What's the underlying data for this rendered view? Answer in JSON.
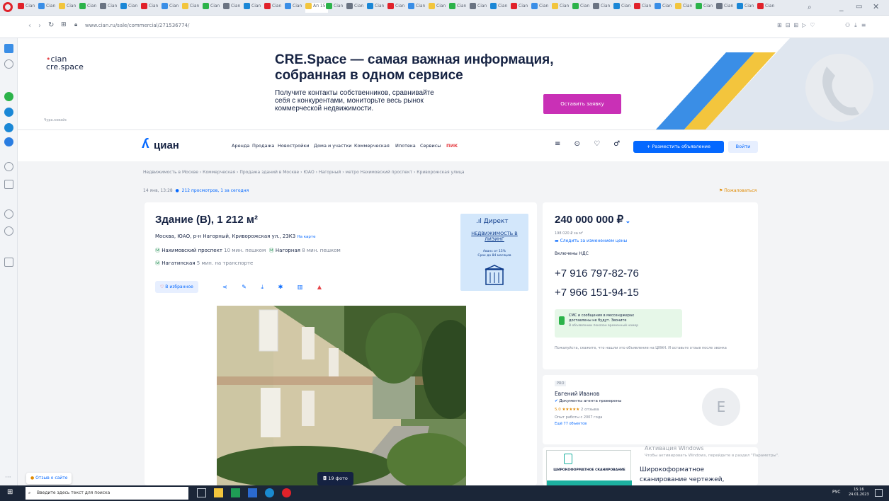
{
  "browser": {
    "url": "www.cian.ru/sale/commercial/271536774/",
    "tabs": [
      {
        "label": "Cian"
      }
    ],
    "active_tab_label": "Ап 15 ×"
  },
  "banner": {
    "logo_line1": "cian",
    "logo_line2": "cre.space",
    "headline_1": "CRE.Space — самая важная информация,",
    "headline_2": "собранная в одном сервисе",
    "body_1": "Получите контакты собственников, сравнивайте",
    "body_2": "себя с конкурентами, мониторьте весь рынок",
    "body_3": "коммерческой недвижимости.",
    "cta": "Оставить заявку",
    "ad_label": "Чура.ковайс"
  },
  "header": {
    "logo": "циан",
    "nav": [
      "Аренда",
      "Продажа",
      "Новостройки",
      "Дома и участки",
      "Коммерческая",
      "Ипотека",
      "Сервисы",
      "ПИК"
    ],
    "post_button": "+ Разместить объявление",
    "login_button": "Войти"
  },
  "breadcrumbs": "Недвижимость в Москве  ›  Коммерческая  ›  Продажа зданий в Москве  ›  ЮАО  ›  Нагорный  ›  метро Нахимовский проспект  ›  Криворожская улица",
  "meta": {
    "date": "14 янв, 13:28",
    "views": "212 просмотров, 1 за сегодня",
    "complain": "Пожаловаться"
  },
  "listing": {
    "title": "Здание (B), 1 212 м²",
    "address": "Москва, ЮАО, р-н Нагорный, Криворожская ул., 23К3",
    "map_link": "На карте",
    "metro": [
      {
        "name": "Нахимовский проспект",
        "time": "10 мин. пешком"
      },
      {
        "name": "Нагорная",
        "time": "8 мин. пешком"
      },
      {
        "name": "Нагатинская",
        "time": "5 мин. на транспорте"
      }
    ],
    "favorite": "В избранное",
    "photo_count": "19 фото"
  },
  "ad_box": {
    "brand": "Директ",
    "title": "НЕДВИЖИМОСТЬ В ЛИЗИНГ",
    "line1": "Аванс от 15%",
    "line2": "Срок до 84 месяцев"
  },
  "price": {
    "value": "240 000 000 ₽",
    "per_m2": "198 020 ₽ за м²",
    "watch": "Следить за изменением цены",
    "vat": "Включены НДС",
    "phone1": "+7 916 797-82-76",
    "phone2": "+7 966 151-94-15",
    "sms_1": "СМС и сообщения в мессенджерах",
    "sms_2": "доставлены не будут. Звоните",
    "sms_3": "В объявлении показан временный номер",
    "note": "Пожалуйста, скажите, что нашли это объявление на ЦИАН. И оставьте отзыв после звонка"
  },
  "agent": {
    "badge": "PRO",
    "name": "Евгений Иванов",
    "verified": "Документы агента проверены",
    "rating": "5.0",
    "reviews": "2 отзыва",
    "experience": "Опыт работы с 2007 года",
    "objects": "Ещё 77 объектов",
    "avatar": "E"
  },
  "promo": {
    "line1": "Широкоформатное",
    "line2": "сканирование чертежей,",
    "logo_text": "ШИРОКОФОРМАТНОЕ СКАНИРОВАНИЕ"
  },
  "windows": {
    "activate_1": "Активация Windows",
    "activate_2": "Чтобы активировать Windows, перейдите в раздел \"Параметры\".",
    "search_placeholder": "Введите здесь текст для поиска",
    "time": "15:16",
    "date": "24.01.2023",
    "lang": "РУС"
  },
  "feedback": "Отзыв о сайте",
  "colors": {
    "accent": "#0468ff",
    "cta": "#c930b6",
    "banner_blue": "#3a8ee6"
  }
}
